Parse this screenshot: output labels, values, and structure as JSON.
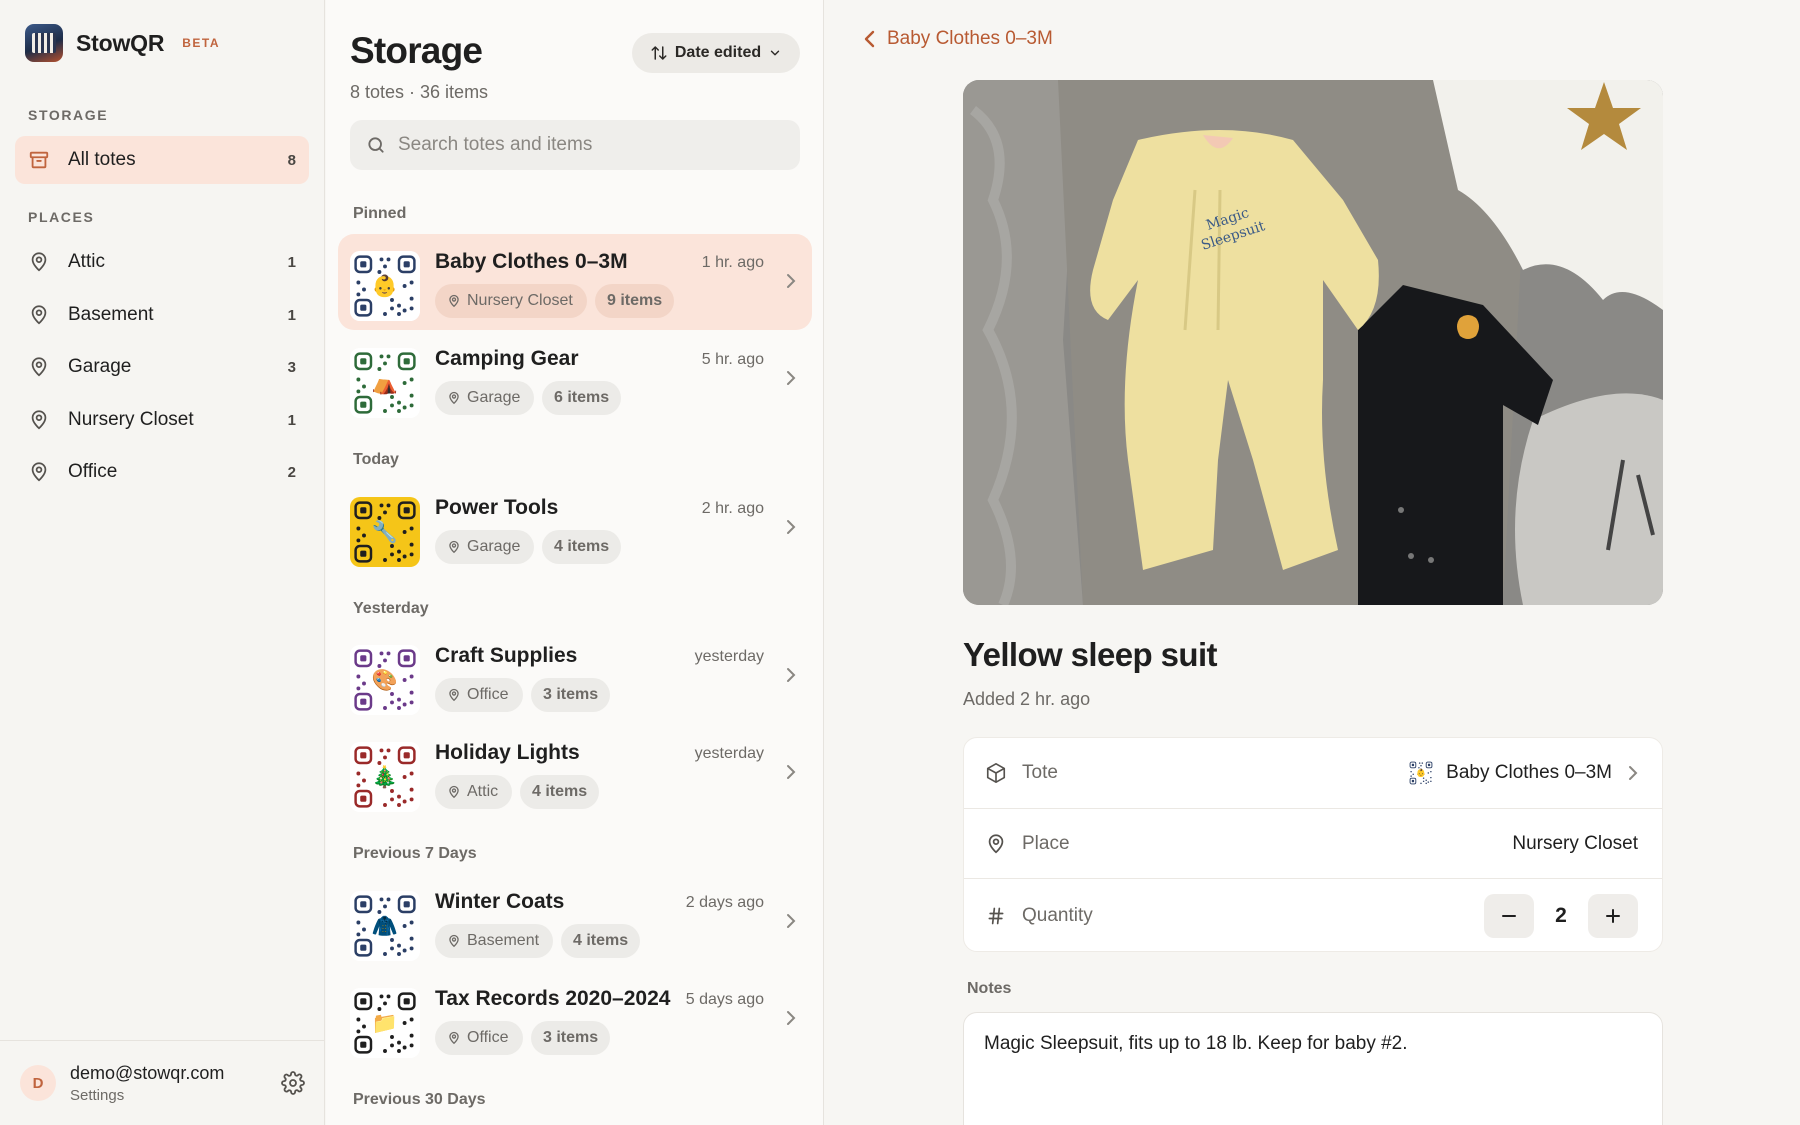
{
  "brand": {
    "name": "StowQR",
    "badge": "BETA"
  },
  "sidebar": {
    "storage_label": "STORAGE",
    "all_totes": {
      "label": "All totes",
      "count": "8"
    },
    "places_label": "PLACES",
    "places": [
      {
        "label": "Attic",
        "count": "1"
      },
      {
        "label": "Basement",
        "count": "1"
      },
      {
        "label": "Garage",
        "count": "3"
      },
      {
        "label": "Nursery Closet",
        "count": "1"
      },
      {
        "label": "Office",
        "count": "2"
      }
    ],
    "user": {
      "initial": "D",
      "email": "demo@stowqr.com",
      "settings_label": "Settings"
    }
  },
  "list": {
    "title": "Storage",
    "subtitle": "8 totes · 36 items",
    "sort_label": "Date edited",
    "search_placeholder": "Search totes and items",
    "groups": {
      "pinned": "Pinned",
      "today": "Today",
      "yesterday": "Yesterday",
      "prev7": "Previous 7 Days",
      "prev30": "Previous 30 Days"
    },
    "totes": [
      {
        "name": "Baby Clothes 0–3M",
        "time": "1 hr. ago",
        "place": "Nursery Closet",
        "items": "9 items",
        "emoji": "👶",
        "color": "#2b3f66"
      },
      {
        "name": "Camping Gear",
        "time": "5 hr. ago",
        "place": "Garage",
        "items": "6 items",
        "emoji": "⛺",
        "color": "#2e6b3a"
      },
      {
        "name": "Power Tools",
        "time": "2 hr. ago",
        "place": "Garage",
        "items": "4 items",
        "emoji": "🔧",
        "color": "#1f1f1f"
      },
      {
        "name": "Craft Supplies",
        "time": "yesterday",
        "place": "Office",
        "items": "3 items",
        "emoji": "🎨",
        "color": "#6b3a8a"
      },
      {
        "name": "Holiday Lights",
        "time": "yesterday",
        "place": "Attic",
        "items": "4 items",
        "emoji": "🎄",
        "color": "#9a2a2a"
      },
      {
        "name": "Winter Coats",
        "time": "2 days ago",
        "place": "Basement",
        "items": "4 items",
        "emoji": "🧥",
        "color": "#2b3f66"
      },
      {
        "name": "Tax Records 2020–2024",
        "time": "5 days ago",
        "place": "Office",
        "items": "3 items",
        "emoji": "📁",
        "color": "#1f1f1f"
      }
    ]
  },
  "detail": {
    "back_label": "Baby Clothes 0–3M",
    "item_title": "Yellow sleep suit",
    "added": "Added 2 hr. ago",
    "tote_label": "Tote",
    "tote_value": "Baby Clothes 0–3M",
    "place_label": "Place",
    "place_value": "Nursery Closet",
    "quantity_label": "Quantity",
    "quantity_value": "2",
    "notes_label": "Notes",
    "notes_text": "Magic Sleepsuit, fits up to 18 lb. Keep for baby #2."
  },
  "colors": {
    "accent": "#c0643e",
    "active_bg": "#fbe4da",
    "back_link": "#b85a32"
  }
}
